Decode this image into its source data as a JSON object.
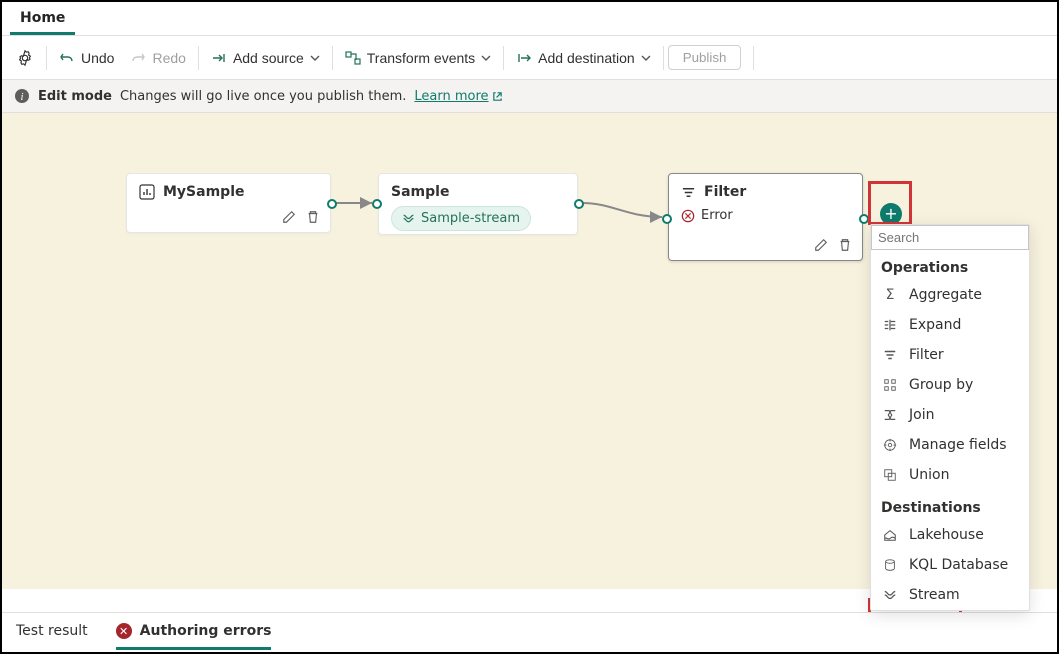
{
  "tabs": {
    "home": "Home"
  },
  "toolbar": {
    "undo": "Undo",
    "redo": "Redo",
    "add_source": "Add source",
    "transform": "Transform events",
    "add_destination": "Add destination",
    "publish": "Publish"
  },
  "infobar": {
    "mode": "Edit mode",
    "desc": "Changes will go live once you publish them.",
    "learn": "Learn more"
  },
  "nodes": {
    "source": {
      "title": "MySample"
    },
    "stream": {
      "title": "Sample",
      "chip": "Sample-stream"
    },
    "filter": {
      "title": "Filter",
      "error": "Error"
    }
  },
  "dropdown": {
    "search_placeholder": "Search",
    "section_operations": "Operations",
    "section_destinations": "Destinations",
    "items_ops": {
      "aggregate": "Aggregate",
      "expand": "Expand",
      "filter": "Filter",
      "groupby": "Group by",
      "join": "Join",
      "manage": "Manage fields",
      "union": "Union"
    },
    "items_dest": {
      "lakehouse": "Lakehouse",
      "kql": "KQL Database",
      "stream": "Stream"
    }
  },
  "bottom": {
    "test_result": "Test result",
    "authoring_errors": "Authoring errors"
  }
}
